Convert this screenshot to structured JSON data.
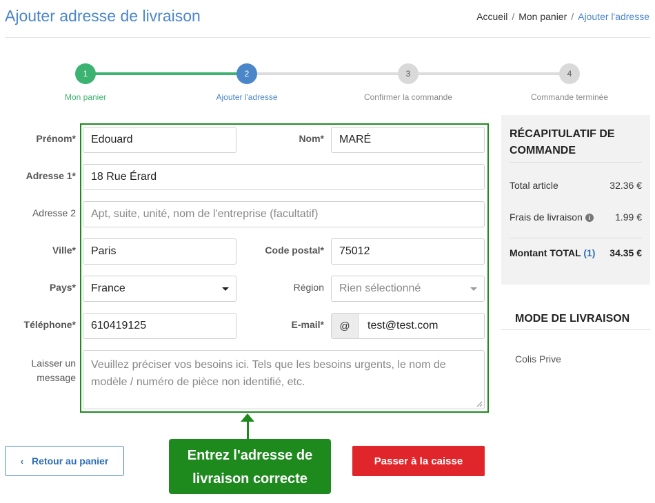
{
  "page": {
    "title": "Ajouter adresse de livraison",
    "breadcrumb": [
      "Accueil",
      "Mon panier",
      "Ajouter l'adresse"
    ],
    "separator": "/"
  },
  "steps": [
    {
      "number": "1",
      "label": "Mon panier",
      "state": "done",
      "color": "#3cb371"
    },
    {
      "number": "2",
      "label": "Ajouter l'adresse",
      "state": "active",
      "color": "#4a86c8"
    },
    {
      "number": "3",
      "label": "Confirmer la commande",
      "state": "pending",
      "color": "#d9d9d9"
    },
    {
      "number": "4",
      "label": "Commande terminée",
      "state": "pending",
      "color": "#d9d9d9"
    }
  ],
  "form": {
    "prenom": {
      "label": "Prénom*",
      "value": "Edouard"
    },
    "nom": {
      "label": "Nom*",
      "value": "MARÉ"
    },
    "adresse1": {
      "label": "Adresse 1*",
      "value": "18 Rue Érard"
    },
    "adresse2": {
      "label": "Adresse 2",
      "placeholder": "Apt, suite, unité, nom de l'entreprise (facultatif)"
    },
    "ville": {
      "label": "Ville*",
      "value": "Paris"
    },
    "code_postal": {
      "label": "Code postal*",
      "value": "75012"
    },
    "pays": {
      "label": "Pays*",
      "value": "France"
    },
    "region": {
      "label": "Région",
      "placeholder": "Rien sélectionné"
    },
    "telephone": {
      "label": "Téléphone*",
      "value": "610419125"
    },
    "email": {
      "label": "E-mail*",
      "addon": "@",
      "value": "test@test.com"
    },
    "message": {
      "label_line1": "Laisser un",
      "label_line2": "message",
      "placeholder_line1": "Veuillez préciser vos besoins ici. Tels que les besoins urgents, le nom de",
      "placeholder_line2": "modèle / numéro de pièce non identifié, etc."
    }
  },
  "summary": {
    "title_line1": "RÉCAPITULATIF DE",
    "title_line2": "COMMANDE",
    "total_article_label": "Total article",
    "total_article_value": "32.36 €",
    "shipping_label": "Frais de livraison",
    "shipping_info_icon": "i",
    "shipping_value": "1.99 €",
    "total_label": "Montant TOTAL",
    "total_count": "(1)",
    "total_value": "34.35 €"
  },
  "shipping_mode": {
    "title": "MODE DE LIVRAISON",
    "option": "Colis Prive"
  },
  "buttons": {
    "back_icon": "‹",
    "back": "Retour au panier",
    "checkout": "Passer à la caisse"
  },
  "annotation": {
    "line1": "Entrez l'adresse de",
    "line2": "livraison correcte",
    "color": "#1e8a1e"
  }
}
